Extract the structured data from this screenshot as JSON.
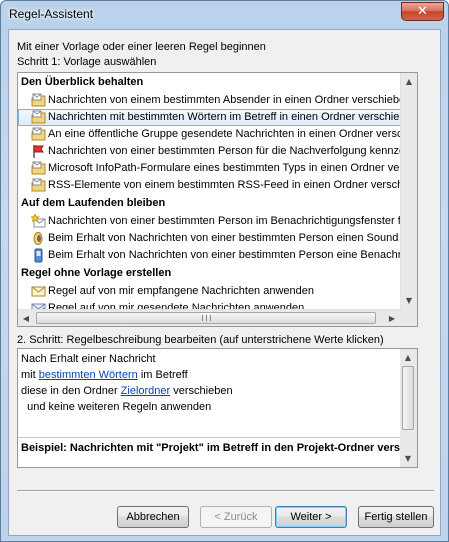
{
  "window": {
    "title": "Regel-Assistent",
    "close_glyph": "✕"
  },
  "intro_text": "Mit einer Vorlage oder einer leeren Regel beginnen",
  "step1_label": "Schritt 1: Vorlage auswählen",
  "templates": {
    "group1": {
      "heading": "Den Überblick behalten",
      "items": [
        "Nachrichten von einem bestimmten Absender in einen Ordner verschieben",
        "Nachrichten mit bestimmten Wörtern im Betreff in einen Ordner verschieben",
        "An eine öffentliche Gruppe gesendete Nachrichten in einen Ordner verschieben",
        "Nachrichten von einer bestimmten Person für die Nachverfolgung kennzeichnen",
        "Microsoft InfoPath-Formulare eines bestimmten Typs in einen Ordner verschieben",
        "RSS-Elemente von einem bestimmten RSS-Feed in einen Ordner verschieben"
      ]
    },
    "group2": {
      "heading": "Auf dem Laufenden bleiben",
      "items": [
        "Nachrichten von einer bestimmten Person im Benachrichtigungsfenster für neue Elemente anzeigen",
        "Beim Erhalt von Nachrichten von einer bestimmten Person einen Sound wiedergeben",
        "Beim Erhalt von Nachrichten von einer bestimmten Person eine Benachrichtigung senden"
      ]
    },
    "group3": {
      "heading": "Regel ohne Vorlage erstellen",
      "items": [
        "Regel auf von mir empfangene Nachrichten anwenden",
        "Regel auf von mir gesendete Nachrichten anwenden"
      ]
    },
    "selected_item": "Nachrichten mit bestimmten Wörtern im Betreff in einen Ordner verschieben"
  },
  "step2_label": "2. Schritt: Regelbeschreibung bearbeiten (auf unterstrichene Werte klicken)",
  "description": {
    "line1": "Nach Erhalt einer Nachricht",
    "line2_pre": "mit ",
    "line2_link": "bestimmten Wörtern",
    "line2_post": " im Betreff",
    "line3_pre": "diese in den Ordner ",
    "line3_link": "Zielordner",
    "line3_post": " verschieben",
    "line4": "  und keine weiteren Regeln anwenden",
    "example": "Beispiel: Nachrichten mit \"Projekt\" im Betreff in den Projekt-Ordner verschieben"
  },
  "buttons": {
    "cancel": "Abbrechen",
    "back": "< Zurück",
    "next": "Weiter >",
    "finish": "Fertig stellen"
  },
  "icons": {
    "move_folder": "folder-envelope-icon",
    "flag": "red-flag-icon",
    "notify": "star-envelope-icon",
    "sound": "speaker-icon",
    "alert": "phone-alert-icon",
    "received": "envelope-icon",
    "sent": "sent-envelope-icon"
  },
  "colors": {
    "link": "#0645ad",
    "selection": "#dcecfb",
    "close_button": "#c7432a"
  }
}
